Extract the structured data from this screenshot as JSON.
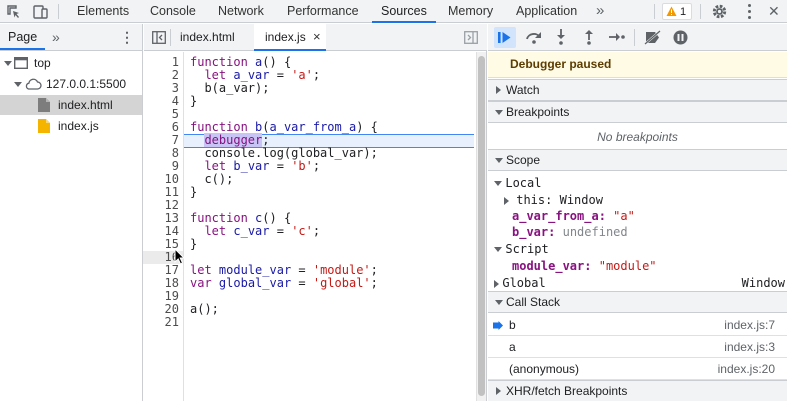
{
  "topbar": {
    "tabs": [
      "Elements",
      "Console",
      "Network",
      "Performance",
      "Sources",
      "Memory",
      "Application"
    ],
    "active_tab": "Sources",
    "more_tabs": "»",
    "warning_count": "1",
    "close_glyph": "✕"
  },
  "navigator": {
    "tab_label": "Page",
    "more": "»",
    "menu": "⋮",
    "tree": [
      {
        "label": "top",
        "icon": "frame-icon",
        "depth": 0,
        "expanded": true
      },
      {
        "label": "127.0.0.1:5500",
        "icon": "cloud-icon",
        "depth": 1,
        "expanded": true
      },
      {
        "label": "index.html",
        "icon": "html-file-icon",
        "depth": 2,
        "selected": true
      },
      {
        "label": "index.js",
        "icon": "js-file-icon",
        "depth": 2,
        "selected": false
      }
    ]
  },
  "editor": {
    "tabs": [
      {
        "label": "index.html",
        "active": false
      },
      {
        "label": "index.js",
        "active": true,
        "close": "×"
      }
    ],
    "paused_line": 7,
    "lines": [
      "1",
      "2",
      "3",
      "4",
      "5",
      "6",
      "7",
      "8",
      "9",
      "10",
      "11",
      "12",
      "13",
      "14",
      "15",
      "16",
      "17",
      "18",
      "19",
      "20",
      "21"
    ]
  },
  "debugger": {
    "paused_message": "Debugger paused",
    "sections": {
      "watch": "Watch",
      "breakpoints": "Breakpoints",
      "no_breakpoints": "No breakpoints",
      "scope": "Scope",
      "call_stack": "Call Stack",
      "xhr": "XHR/fetch Breakpoints"
    },
    "scope": {
      "local_label": "Local",
      "this_key": "this",
      "this_value": "Window",
      "var1_key": "a_var_from_a",
      "var1_value": "\"a\"",
      "var2_key": "b_var",
      "var2_value": "undefined",
      "script_label": "Script",
      "var3_key": "module_var",
      "var3_value": "\"module\"",
      "global_label": "Global",
      "global_value": "Window"
    },
    "call_stack": [
      {
        "fn": "b",
        "loc": "index.js:7",
        "current": true
      },
      {
        "fn": "a",
        "loc": "index.js:3",
        "current": false
      },
      {
        "fn": "(anonymous)",
        "loc": "index.js:20",
        "current": false
      }
    ]
  },
  "colors": {
    "accent": "#1a73e8",
    "paused_bg": "#fffbe5",
    "exec_line": "#e8f0fe"
  }
}
